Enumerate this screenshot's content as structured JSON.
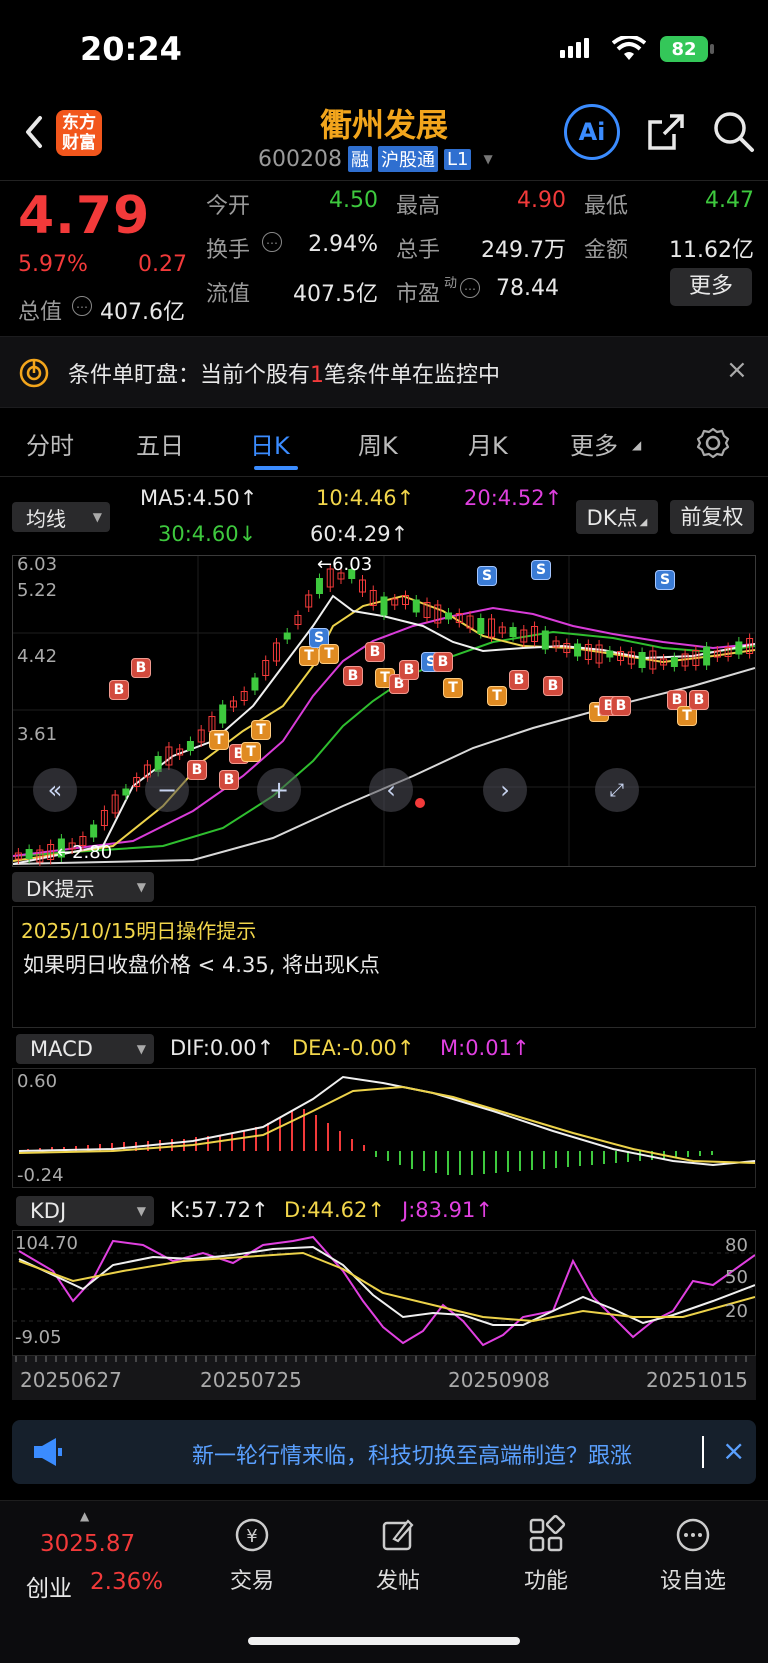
{
  "status_bar": {
    "time": "20:24",
    "battery": "82"
  },
  "header": {
    "logo_line1": "东方",
    "logo_line2": "财富",
    "title": "衢州发展",
    "code": "600208",
    "tags": [
      "融",
      "沪股通",
      "L1"
    ]
  },
  "quote": {
    "price": "4.79",
    "change_pct": "5.97%",
    "change": "0.27",
    "grid": [
      {
        "label": "今开",
        "value": "4.50",
        "color": "green"
      },
      {
        "label": "最高",
        "value": "4.90",
        "color": "red"
      },
      {
        "label": "最低",
        "value": "4.47",
        "color": "green"
      },
      {
        "label": "换手",
        "value": "2.94%",
        "color": "white"
      },
      {
        "label": "总手",
        "value": "249.7万",
        "color": "white"
      },
      {
        "label": "金额",
        "value": "11.62亿",
        "color": "white"
      },
      {
        "label": "流值",
        "value": "407.5亿",
        "color": "white"
      },
      {
        "label": "市盈",
        "value": "78.44",
        "color": "white"
      }
    ],
    "total_value_label": "总值",
    "total_value": "407.6亿",
    "pe_superscript": "动",
    "more_label": "更多"
  },
  "notice": {
    "prefix": "条件单盯盘：当前个股有",
    "count": "1",
    "suffix": "笔条件单在监控中"
  },
  "tabs": [
    "分时",
    "五日",
    "日K",
    "周K",
    "月K",
    "更多"
  ],
  "active_tab": "日K",
  "ma": {
    "dropdown": "均线",
    "ma5": "MA5:4.50",
    "ma10": "10:4.46",
    "ma20": "20:4.52",
    "ma30": "30:4.60",
    "ma60": "60:4.29",
    "dk_button": "DK点",
    "adjust_button": "前复权"
  },
  "kline": {
    "y_labels": [
      "6.03",
      "5.22",
      "4.42",
      "3.61"
    ],
    "high_marker": "6.03",
    "low_marker": "2.80"
  },
  "dk": {
    "dropdown": "DK提示",
    "date_line": "2025/10/15明日操作提示",
    "tip": "如果明日收盘价格 < 4.35, 将出现K点"
  },
  "macd": {
    "dropdown": "MACD",
    "dif": "DIF:0.00",
    "dea": "DEA:-0.00",
    "m": "M:0.01",
    "y_top": "0.60",
    "y_bottom": "-0.24"
  },
  "kdj": {
    "dropdown": "KDJ",
    "k": "K:57.72",
    "d": "D:44.62",
    "j": "J:83.91",
    "y_top": "104.70",
    "y_bottom": "-9.05",
    "right_labels": [
      "80",
      "50",
      "20"
    ]
  },
  "x_dates": [
    "20250627",
    "20250725",
    "20250908",
    "20251015"
  ],
  "banner": {
    "text": "新一轮行情来临，科技切换至高端制造？跟涨"
  },
  "bottom_nav": {
    "index_value": "3025.87",
    "index_name": "创业",
    "index_change": "2.36%",
    "items": [
      "交易",
      "发帖",
      "功能",
      "设自选"
    ]
  },
  "colors": {
    "up": "#f23a3a",
    "down": "#3ec93e",
    "accent": "#f2a51c",
    "tab_active": "#3b8cff"
  }
}
